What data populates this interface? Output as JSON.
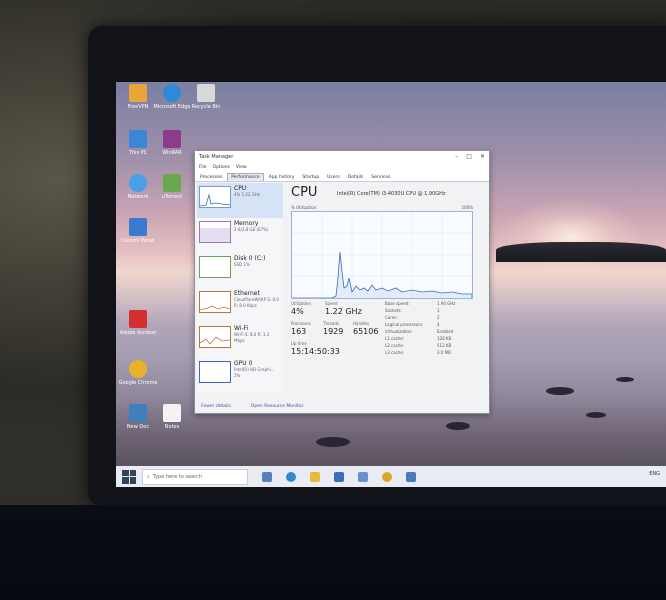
{
  "desktop_icons": [
    {
      "label": "FreeVPN",
      "color": "#e8a53a"
    },
    {
      "label": "Microsoft Edge",
      "color": "#2f89d6"
    },
    {
      "label": "Recycle Bin",
      "color": "#d9d9d9"
    },
    {
      "label": "This PC",
      "color": "#3b86d6"
    },
    {
      "label": "WinRAR",
      "color": "#8f3b8d"
    },
    {
      "label": "Network",
      "color": "#4aa0e6"
    },
    {
      "label": "uTorrent",
      "color": "#6aa84f"
    },
    {
      "label": "Control Panel",
      "color": "#3c7ad1"
    },
    {
      "label": "Adobe Acrobat",
      "color": "#d32f2f"
    },
    {
      "label": "Google Chrome",
      "color": "#e8b32a"
    },
    {
      "label": "New Doc",
      "color": "#3f7fbf"
    },
    {
      "label": "Notes",
      "color": "#f3f3f3"
    }
  ],
  "task_manager": {
    "title": "Task Manager",
    "menu": [
      "File",
      "Options",
      "View"
    ],
    "tabs": [
      "Processes",
      "Performance",
      "App history",
      "Startup",
      "Users",
      "Details",
      "Services"
    ],
    "active_tab": "Performance",
    "sidebar": [
      {
        "name": "CPU",
        "sub": "4% 1.22 GHz"
      },
      {
        "name": "Memory",
        "sub": "2.6/3.8 GB (67%)"
      },
      {
        "name": "Disk 0 (C:)",
        "sub": "SSD\n1%"
      },
      {
        "name": "Ethernet",
        "sub": "CloudflareWARP\nS: 8.0 R: 8.0 Kbps"
      },
      {
        "name": "Wi-Fi",
        "sub": "Wi-Fi\nS: 8.0 R: 1.2 Mbps"
      },
      {
        "name": "GPU 0",
        "sub": "Intel(R) HD Graphi...\n2%"
      }
    ],
    "cpu": {
      "heading": "CPU",
      "model": "Intel(R) Core(TM) i3-4030U CPU @ 1.90GHz",
      "util_label": "% Utilization",
      "util_max": "100%",
      "utilization_label": "Utilization",
      "utilization_value": "4%",
      "speed_label": "Speed",
      "speed_value": "1.22 GHz",
      "processes_label": "Processes",
      "processes_value": "163",
      "threads_label": "Threads",
      "threads_value": "1929",
      "handles_label": "Handles",
      "handles_value": "65106",
      "uptime_label": "Up time",
      "uptime_value": "15:14:50:33",
      "specs": [
        {
          "label": "Base speed:",
          "value": "1.90 GHz"
        },
        {
          "label": "Sockets:",
          "value": "1"
        },
        {
          "label": "Cores:",
          "value": "2"
        },
        {
          "label": "Logical processors:",
          "value": "4"
        },
        {
          "label": "Virtualization:",
          "value": "Enabled"
        },
        {
          "label": "L1 cache:",
          "value": "128 KB"
        },
        {
          "label": "L2 cache:",
          "value": "512 KB"
        },
        {
          "label": "L3 cache:",
          "value": "3.0 MB"
        }
      ]
    },
    "footer": {
      "fewer": "Fewer details",
      "monitor": "Open Resource Monitor"
    }
  },
  "taskbar": {
    "search_placeholder": "Type here to search",
    "tray_text": "ENG"
  }
}
